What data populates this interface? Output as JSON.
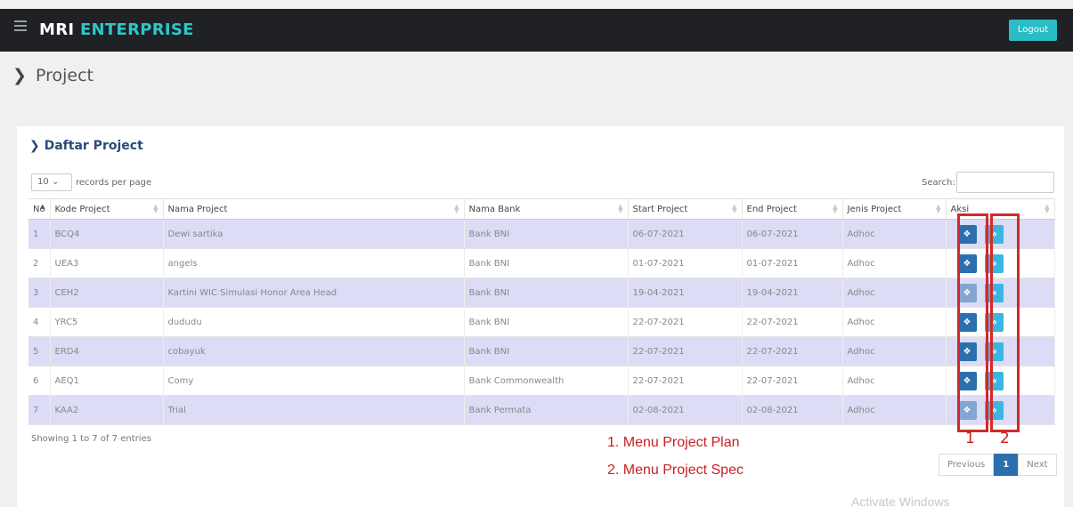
{
  "header": {
    "brand_part1": "MRI",
    "brand_part2": "ENTERPRISE",
    "logout_label": "Logout"
  },
  "page": {
    "title": "Project"
  },
  "panel": {
    "title": "Daftar Project",
    "length_value": "10",
    "length_suffix": "records per page",
    "search_label": "Search:",
    "search_value": "",
    "info": "Showing 1 to 7 of 7 entries"
  },
  "table": {
    "columns": [
      "No",
      "Kode Project",
      "Nama Project",
      "Nama Bank",
      "Start Project",
      "End Project",
      "Jenis Project",
      "Aksi"
    ],
    "rows": [
      [
        "1",
        "BCQ4",
        "Dewi sartika",
        "Bank BNI",
        "06-07-2021",
        "06-07-2021",
        "Adhoc"
      ],
      [
        "2",
        "UEA3",
        "angels",
        "Bank BNI",
        "01-07-2021",
        "01-07-2021",
        "Adhoc"
      ],
      [
        "3",
        "CEH2",
        "Kartini WIC Simulasi Honor Area Head",
        "Bank BNI",
        "19-04-2021",
        "19-04-2021",
        "Adhoc"
      ],
      [
        "4",
        "YRC5",
        "dududu",
        "Bank BNI",
        "22-07-2021",
        "22-07-2021",
        "Adhoc"
      ],
      [
        "5",
        "ERD4",
        "cobayuk",
        "Bank BNI",
        "22-07-2021",
        "22-07-2021",
        "Adhoc"
      ],
      [
        "6",
        "AEQ1",
        "Comy",
        "Bank Commonwealth",
        "22-07-2021",
        "22-07-2021",
        "Adhoc"
      ],
      [
        "7",
        "KAA2",
        "Trial",
        "Bank Permata",
        "02-08-2021",
        "02-08-2021",
        "Adhoc"
      ]
    ],
    "plan_button_icon": "puzzle-icon",
    "spec_button_icon": "double-chevron-right-icon"
  },
  "pagination": {
    "previous": "Previous",
    "current": "1",
    "next": "Next"
  },
  "annotations": {
    "num1": "1",
    "num2": "2",
    "line1": "1. Menu Project Plan",
    "line2": "2. Menu Project Spec"
  },
  "watermark": "Activate Windows",
  "colors": {
    "topbar": "#1f2125",
    "brand_accent": "#2ec7c9",
    "logout": "#2bbdc6",
    "plan_button": "#2c6fae",
    "spec_button": "#3ab6e3",
    "row_stripe": "#dcdcf6",
    "annotation": "#d12a2a"
  }
}
